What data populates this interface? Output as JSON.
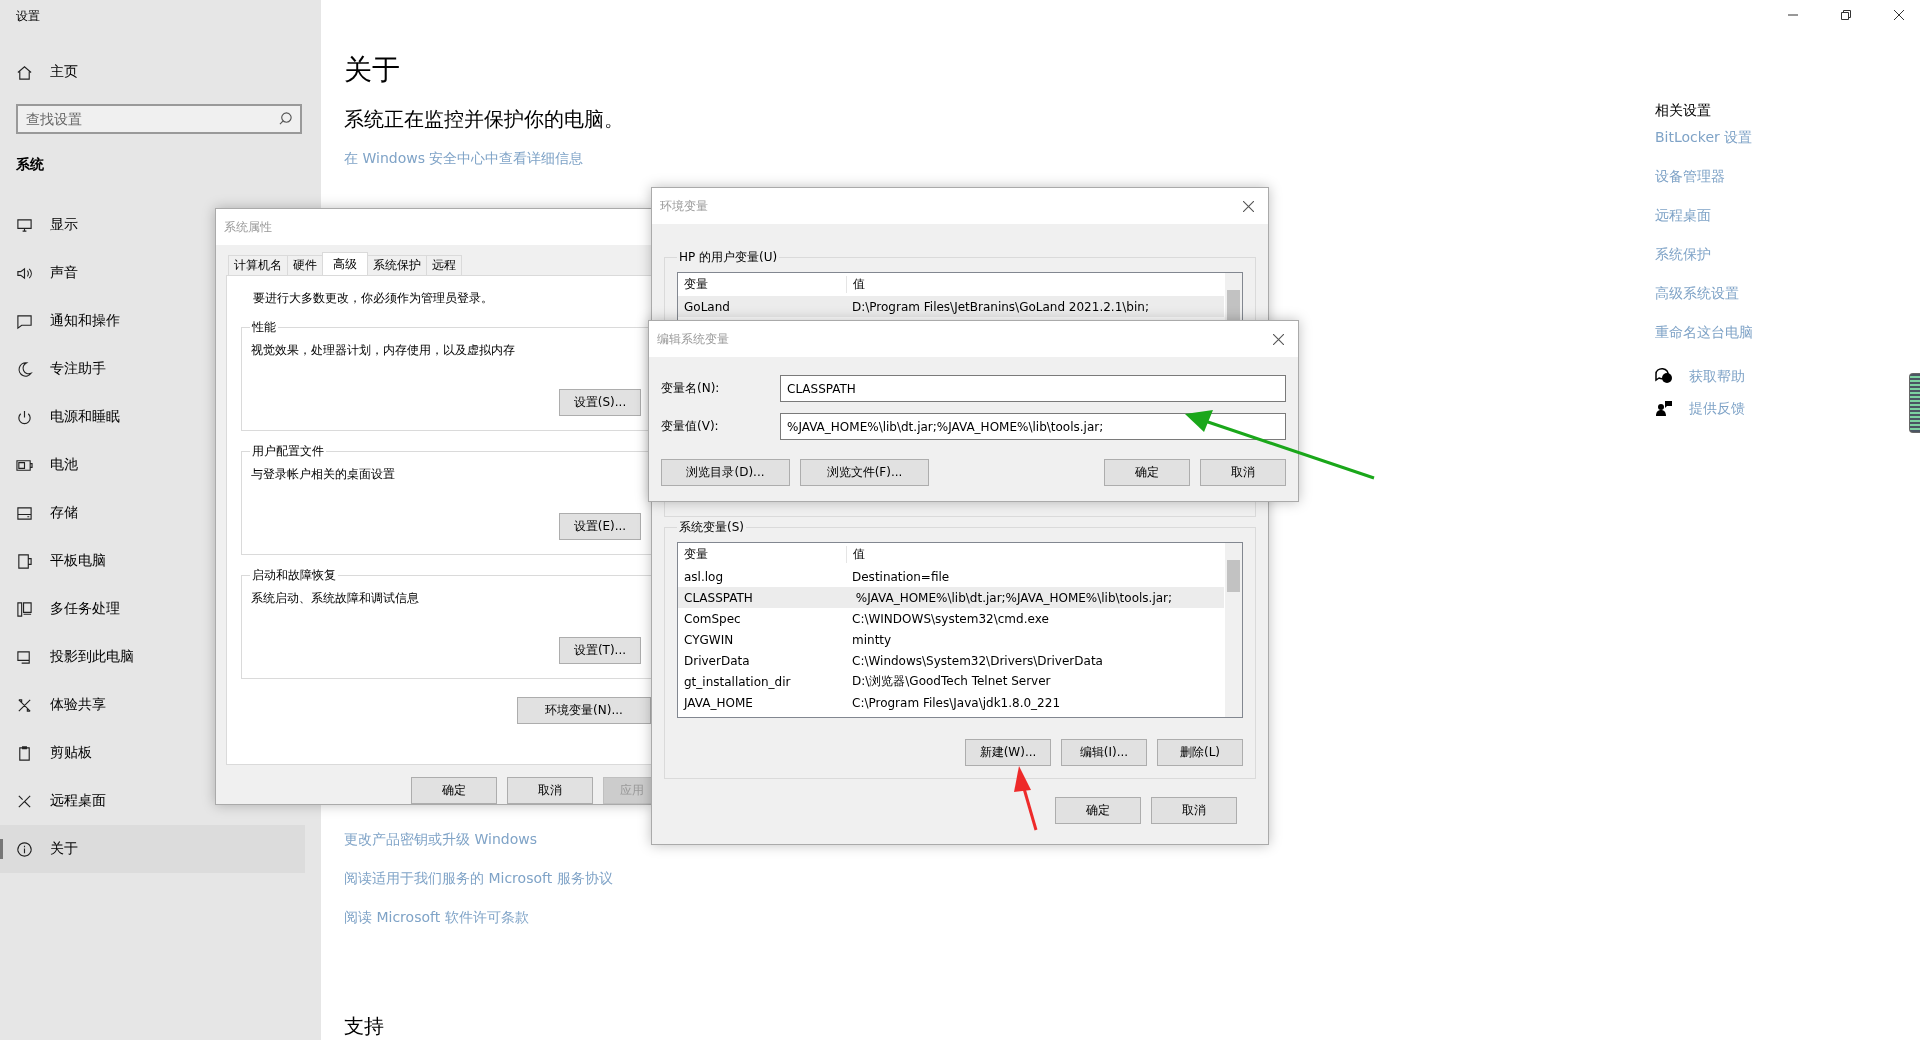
{
  "settings": {
    "title": "设置",
    "home": "主页",
    "search": {
      "placeholder": "查找设置"
    },
    "category": "系统",
    "nav_items": [
      {
        "label": "显示",
        "selected": false
      },
      {
        "label": "声音",
        "selected": false
      },
      {
        "label": "通知和操作",
        "selected": false
      },
      {
        "label": "专注助手",
        "selected": false
      },
      {
        "label": "电源和睡眠",
        "selected": false
      },
      {
        "label": "电池",
        "selected": false
      },
      {
        "label": "存储",
        "selected": false
      },
      {
        "label": "平板电脑",
        "selected": false
      },
      {
        "label": "多任务处理",
        "selected": false
      },
      {
        "label": "投影到此电脑",
        "selected": false
      },
      {
        "label": "体验共享",
        "selected": false
      },
      {
        "label": "剪贴板",
        "selected": false
      },
      {
        "label": "远程桌面",
        "selected": false
      },
      {
        "label": "关于",
        "selected": true
      }
    ],
    "page_title": "关于",
    "status": "系统正在监控并保护你的电脑。",
    "security_link": "在 Windows 安全中心中查看详细信息",
    "links": [
      "更改产品密钥或升级 Windows",
      "阅读适用于我们服务的 Microsoft 服务协议",
      "阅读 Microsoft 软件许可条款"
    ],
    "support_heading": "支持",
    "related": {
      "title": "相关设置",
      "links": [
        "BitLocker 设置",
        "设备管理器",
        "远程桌面",
        "系统保护",
        "高级系统设置",
        "重命名这台电脑"
      ]
    },
    "help": [
      "获取帮助",
      "提供反馈"
    ]
  },
  "system_properties": {
    "title": "系统属性",
    "tabs": [
      {
        "label": "计算机名",
        "selected": false
      },
      {
        "label": "硬件",
        "selected": false
      },
      {
        "label": "高级",
        "selected": true
      },
      {
        "label": "系统保护",
        "selected": false
      },
      {
        "label": "远程",
        "selected": false
      }
    ],
    "admin_note": "要进行大多数更改，你必须作为管理员登录。",
    "groups": [
      {
        "title": "性能",
        "description": "视觉效果，处理器计划，内存使用，以及虚拟内存",
        "button": "设置(S)..."
      },
      {
        "title": "用户配置文件",
        "description": "与登录帐户相关的桌面设置",
        "button": "设置(E)..."
      },
      {
        "title": "启动和故障恢复",
        "description": "系统启动、系统故障和调试信息",
        "button": "设置(T)..."
      }
    ],
    "env_button": "环境变量(N)...",
    "buttons": [
      "确定",
      "取消",
      "应用"
    ]
  },
  "environment_variables": {
    "title": "环境变量",
    "user_group": "HP 的用户变量(U)",
    "user_columns": [
      "变量",
      "值"
    ],
    "user_rows": [
      {
        "name": "GoLand",
        "value": "D:\\Program Files\\JetBranins\\GoLand 2021.2.1\\bin;",
        "selected": true
      }
    ],
    "system_group": "系统变量(S)",
    "system_columns": [
      "变量",
      "值"
    ],
    "system_rows": [
      {
        "name": "asl.log",
        "value": "Destination=file",
        "selected": false
      },
      {
        "name": "CLASSPATH",
        "value": " %JAVA_HOME%\\lib\\dt.jar;%JAVA_HOME%\\lib\\tools.jar;",
        "selected": true
      },
      {
        "name": "ComSpec",
        "value": "C:\\WINDOWS\\system32\\cmd.exe",
        "selected": false
      },
      {
        "name": "CYGWIN",
        "value": "mintty",
        "selected": false
      },
      {
        "name": "DriverData",
        "value": "C:\\Windows\\System32\\Drivers\\DriverData",
        "selected": false
      },
      {
        "name": "gt_installation_dir",
        "value": "D:\\浏览器\\GoodTech Telnet Server",
        "selected": false
      },
      {
        "name": "JAVA_HOME",
        "value": "C:\\Program Files\\Java\\jdk1.8.0_221",
        "selected": false
      }
    ],
    "list_buttons": [
      "新建(W)...",
      "编辑(I)...",
      "删除(L)"
    ],
    "buttons": [
      "确定",
      "取消"
    ]
  },
  "edit_dialog": {
    "title": "编辑系统变量",
    "name_label": "变量名(N):",
    "name_value": "CLASSPATH",
    "value_label": "变量值(V):",
    "value_value": "%JAVA_HOME%\\lib\\dt.jar;%JAVA_HOME%\\lib\\tools.jar;",
    "buttons": [
      "浏览目录(D)...",
      "浏览文件(F)..."
    ],
    "confirm_buttons": [
      "确定",
      "取消"
    ]
  }
}
